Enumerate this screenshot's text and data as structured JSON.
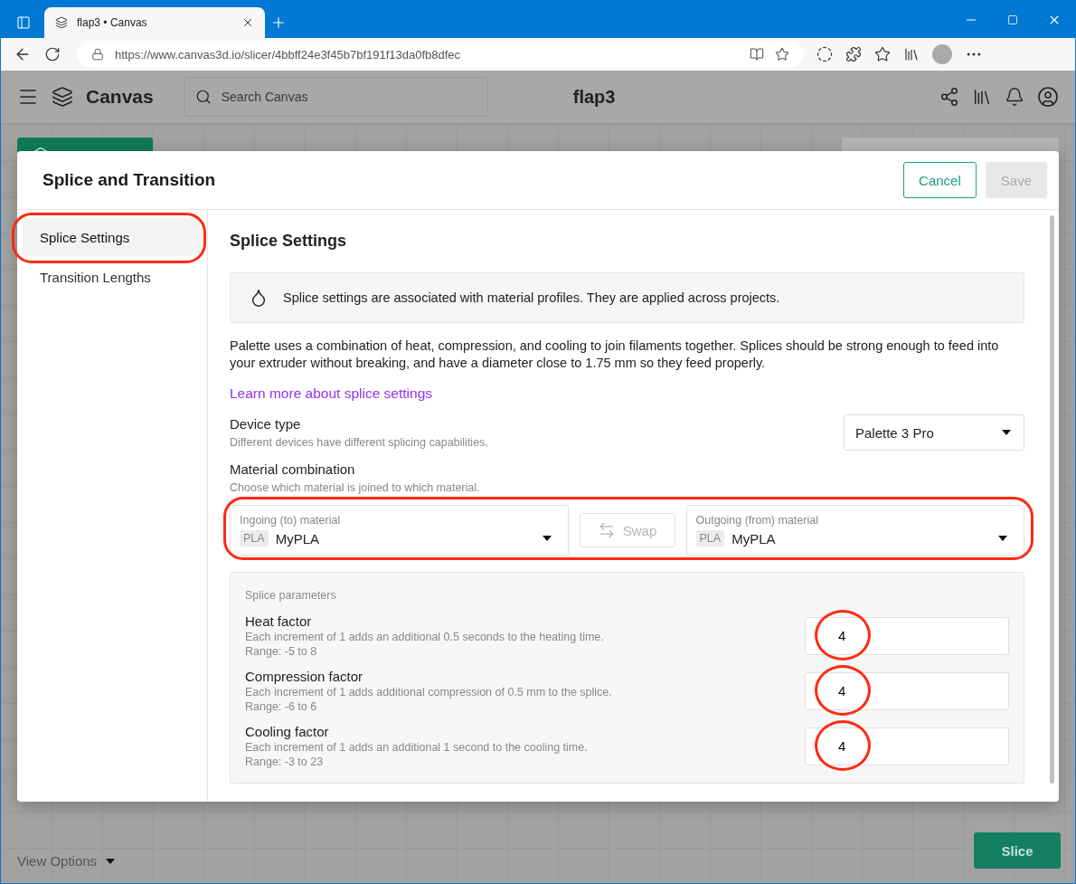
{
  "browser": {
    "tab_title": "flap3 • Canvas",
    "url": "https://www.canvas3d.io/slicer/4bbff24e3f45b7bf191f13da0fb8dfec"
  },
  "app": {
    "brand": "Canvas",
    "search": {
      "placeholder": "Search Canvas"
    },
    "project_title": "flap3",
    "view_options": "View Options",
    "slice_button": "Slice"
  },
  "dialog": {
    "title": "Splice and Transition",
    "buttons": [
      {
        "kind": "outline",
        "label": "Cancel",
        "disabled": false
      },
      {
        "kind": "primary",
        "label": "Save",
        "disabled": true
      }
    ],
    "nav": [
      {
        "label": "Splice Settings",
        "selected": true,
        "highlighted": true
      },
      {
        "label": "Transition Lengths",
        "selected": false,
        "highlighted": false
      }
    ],
    "section_title": "Splice Settings",
    "notice": "Splice settings are associated with material profiles. They are applied across projects.",
    "description": "Palette uses a combination of heat, compression, and cooling to join filaments together. Splices should be strong enough to feed into your extruder without breaking, and have a diameter close to 1.75 mm so they feed properly.",
    "link": "Learn more about splice settings",
    "device_type": {
      "label": "Device type",
      "hint": "Different devices have different splicing capabilities.",
      "value": "Palette 3 Pro"
    },
    "material_combination": {
      "label": "Material combination",
      "hint": "Choose which material is joined to which material.",
      "highlighted": true,
      "ingoing": {
        "label": "Ingoing (to) material",
        "tag": "PLA",
        "value": "MyPLA"
      },
      "swap": {
        "label": "Swap",
        "disabled": true
      },
      "outgoing": {
        "label": "Outgoing (from) material",
        "tag": "PLA",
        "value": "MyPLA"
      }
    },
    "parameters": {
      "title": "Splice parameters",
      "items": [
        {
          "label": "Heat factor",
          "description": "Each increment of 1 adds an additional 0.5 seconds to the heating time.",
          "range": "Range: -5 to 8",
          "value": "4",
          "highlighted": true
        },
        {
          "label": "Compression factor",
          "description": "Each increment of 1 adds additional compression of 0.5 mm to the splice.",
          "range": "Range: -6 to 6",
          "value": "4",
          "highlighted": true
        },
        {
          "label": "Cooling factor",
          "description": "Each increment of 1 adds an additional 1 second to the cooling time.",
          "range": "Range: -3 to 23",
          "value": "4",
          "highlighted": true
        }
      ]
    }
  }
}
